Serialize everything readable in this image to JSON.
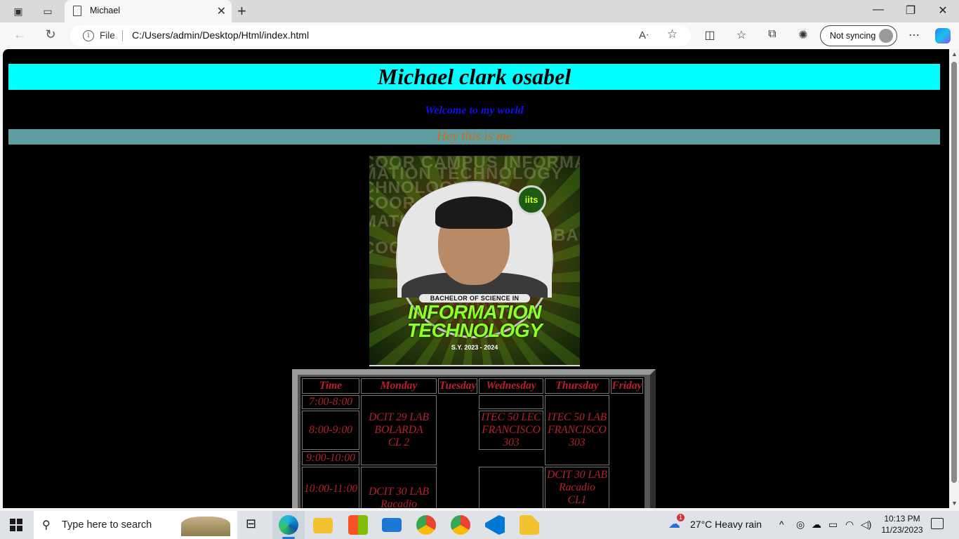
{
  "browser": {
    "tab_title": "Michael",
    "omnibox_scheme_label": "File",
    "url": "C:/Users/admin/Desktop/Html/index.html",
    "sync_label": "Not syncing"
  },
  "page": {
    "heading": "Michael clark osabel",
    "welcome": "Welcome to my world",
    "subheading": "Hey this is me",
    "poster": {
      "background_text": [
        "COOR CAMPUS INFORMATI",
        "MATION TECHNOLOGY",
        "CHNOLOGY BAC",
        "COOR CAMP",
        "MATIO",
        "BAC",
        "COOR"
      ],
      "badge": "iits",
      "degree_line": "BACHELOR OF SCIENCE IN",
      "program_line1": "INFORMATION",
      "program_line2": "TECHNOLOGY",
      "school_year": "S.Y. 2023 - 2024"
    },
    "schedule": {
      "headers": [
        "Time",
        "Monday",
        "Tuesday",
        "Wednesday",
        "Thursday",
        "Friday"
      ],
      "times": [
        "7:00-8:00",
        "8:00-9:00",
        "9:00-10:00",
        "10:00-11:00"
      ],
      "monday_1": [
        "DCIT 29 LAB",
        "BOLARDA",
        "CL 2"
      ],
      "monday_2": [
        "DCIT 30 LAB",
        "Racadio"
      ],
      "wednesday_1": [
        "ITEC 50 LEC",
        "FRANCISCO",
        "303"
      ],
      "thursday_1": [
        "ITEC 50 LAB",
        "FRANCISCO",
        "303"
      ],
      "thursday_2": [
        "DCIT 30 LAB",
        "Racadio",
        "CL1"
      ]
    }
  },
  "taskbar": {
    "search_placeholder": "Type here to search",
    "weather": "27°C  Heavy rain",
    "weather_badge": "1",
    "time": "10:13 PM",
    "date": "11/23/2023"
  },
  "colors": {
    "heading_bg": "#00ffff",
    "subheading_bg": "#5f9ea0",
    "welcome_text": "#1010ee",
    "subheading_text": "#d2691e",
    "schedule_text": "#b8202a"
  }
}
